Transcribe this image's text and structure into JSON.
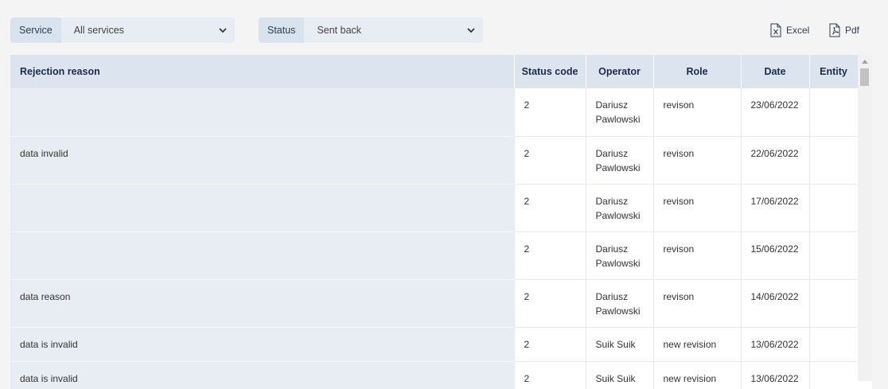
{
  "filters": {
    "service": {
      "label": "Service",
      "value": "All services"
    },
    "status": {
      "label": "Status",
      "value": "Sent back"
    }
  },
  "export": {
    "excel": "Excel",
    "pdf": "Pdf"
  },
  "table": {
    "headers": {
      "reason": "Rejection reason",
      "status_code": "Status code",
      "operator": "Operator",
      "role": "Role",
      "date": "Date",
      "entity": "Entity"
    },
    "rows": [
      {
        "reason": "",
        "status_code": "2",
        "operator": "Dariusz Pawlowski",
        "role": "revison",
        "date": "23/06/2022",
        "entity": ""
      },
      {
        "reason": "data invalid",
        "status_code": "2",
        "operator": "Dariusz Pawlowski",
        "role": "revison",
        "date": "22/06/2022",
        "entity": ""
      },
      {
        "reason": "",
        "status_code": "2",
        "operator": "Dariusz Pawlowski",
        "role": "revison",
        "date": "17/06/2022",
        "entity": ""
      },
      {
        "reason": "",
        "status_code": "2",
        "operator": "Dariusz Pawlowski",
        "role": "revison",
        "date": "15/06/2022",
        "entity": ""
      },
      {
        "reason": "data reason",
        "status_code": "2",
        "operator": "Dariusz Pawlowski",
        "role": "revison",
        "date": "14/06/2022",
        "entity": ""
      },
      {
        "reason": "data is invalid",
        "status_code": "2",
        "operator": "Suik Suik",
        "role": "new revision",
        "date": "13/06/2022",
        "entity": ""
      },
      {
        "reason": "data is invalid",
        "status_code": "2",
        "operator": "Suik Suik",
        "role": "new revision",
        "date": "13/06/2022",
        "entity": ""
      }
    ]
  }
}
